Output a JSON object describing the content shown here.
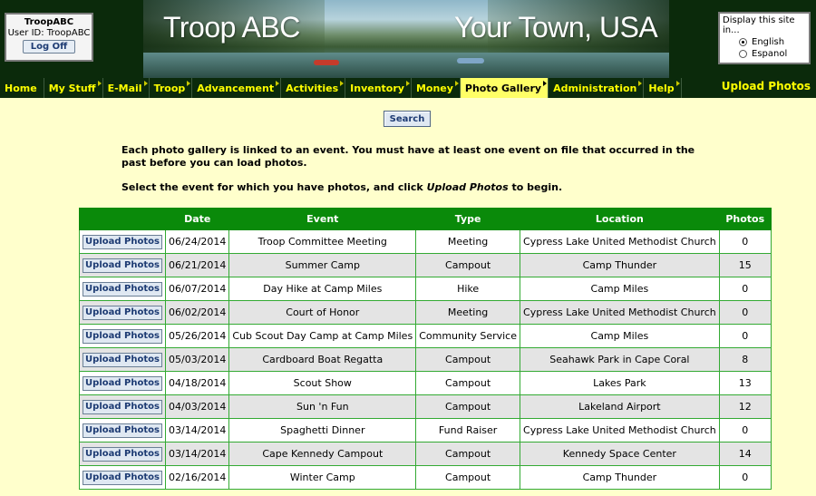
{
  "login": {
    "troop": "TroopABC",
    "user_id_text": "User ID:  TroopABC",
    "logoff_label": "Log Off"
  },
  "banner": {
    "left_text": "Troop ABC",
    "right_text": "Your Town, USA"
  },
  "language": {
    "title": "Display this site in...",
    "options": [
      {
        "label": "English",
        "selected": true
      },
      {
        "label": "Espanol",
        "selected": false
      }
    ]
  },
  "nav": {
    "items": [
      {
        "label": "Home"
      },
      {
        "label": "My Stuff"
      },
      {
        "label": "E-Mail"
      },
      {
        "label": "Troop"
      },
      {
        "label": "Advancement"
      },
      {
        "label": "Activities"
      },
      {
        "label": "Inventory"
      },
      {
        "label": "Money"
      },
      {
        "label": "Photo Gallery"
      },
      {
        "label": "Administration"
      },
      {
        "label": "Help"
      }
    ],
    "active": "Photo Gallery",
    "page_label": "Upload Photos"
  },
  "search": {
    "label": "Search"
  },
  "instructions": {
    "p1": "Each photo gallery is linked to an event. You must have at least one event on file that occurred in the past before you can load photos.",
    "p2_before": "Select the event for which you have photos, and click ",
    "p2_em": "Upload Photos",
    "p2_after": " to begin."
  },
  "table": {
    "headers": [
      "",
      "Date",
      "Event",
      "Type",
      "Location",
      "Photos"
    ],
    "button_label": "Upload Photos",
    "rows": [
      {
        "date": "06/24/2014",
        "event": "Troop Committee Meeting",
        "type": "Meeting",
        "location": "Cypress Lake United Methodist Church",
        "photos": "0"
      },
      {
        "date": "06/21/2014",
        "event": "Summer Camp",
        "type": "Campout",
        "location": "Camp Thunder",
        "photos": "15"
      },
      {
        "date": "06/07/2014",
        "event": "Day Hike at Camp Miles",
        "type": "Hike",
        "location": "Camp Miles",
        "photos": "0"
      },
      {
        "date": "06/02/2014",
        "event": "Court of Honor",
        "type": "Meeting",
        "location": "Cypress Lake United Methodist Church",
        "photos": "0"
      },
      {
        "date": "05/26/2014",
        "event": "Cub Scout Day Camp at Camp Miles",
        "type": "Community Service",
        "location": "Camp Miles",
        "photos": "0"
      },
      {
        "date": "05/03/2014",
        "event": "Cardboard Boat Regatta",
        "type": "Campout",
        "location": "Seahawk Park in Cape Coral",
        "photos": "8"
      },
      {
        "date": "04/18/2014",
        "event": "Scout Show",
        "type": "Campout",
        "location": "Lakes Park",
        "photos": "13"
      },
      {
        "date": "04/03/2014",
        "event": "Sun 'n Fun",
        "type": "Campout",
        "location": "Lakeland Airport",
        "photos": "12"
      },
      {
        "date": "03/14/2014",
        "event": "Spaghetti Dinner",
        "type": "Fund Raiser",
        "location": "Cypress Lake United Methodist Church",
        "photos": "0"
      },
      {
        "date": "03/14/2014",
        "event": "Cape Kennedy Campout",
        "type": "Campout",
        "location": "Kennedy Space Center",
        "photos": "14"
      },
      {
        "date": "02/16/2014",
        "event": "Winter Camp",
        "type": "Campout",
        "location": "Camp Thunder",
        "photos": "0"
      }
    ]
  },
  "colors": {
    "page_bg": "#ffffcc",
    "header_bg": "#0b2a0b",
    "nav_text": "#ffff00",
    "nav_active_bg": "#ffff66",
    "table_header_bg": "#0a8a0a",
    "table_border": "#33aa33",
    "row_alt_bg": "#e4e4e4",
    "button_text": "#1d3b73"
  }
}
